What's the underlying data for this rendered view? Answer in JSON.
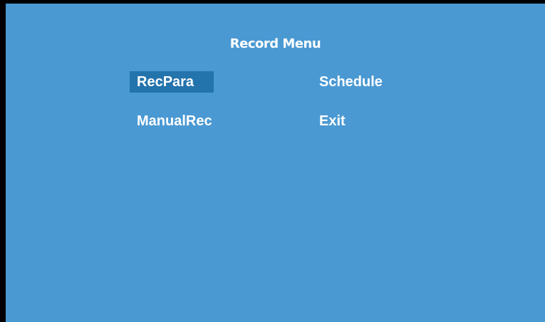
{
  "menu": {
    "title": "Record Menu",
    "items": [
      {
        "label": "RecPara",
        "selected": true
      },
      {
        "label": "Schedule",
        "selected": false
      },
      {
        "label": "ManualRec",
        "selected": false
      },
      {
        "label": "Exit",
        "selected": false
      }
    ]
  },
  "colors": {
    "background": "#4a99d3",
    "border": "#000000",
    "selection": "#2373ac",
    "text": "#ffffff"
  }
}
